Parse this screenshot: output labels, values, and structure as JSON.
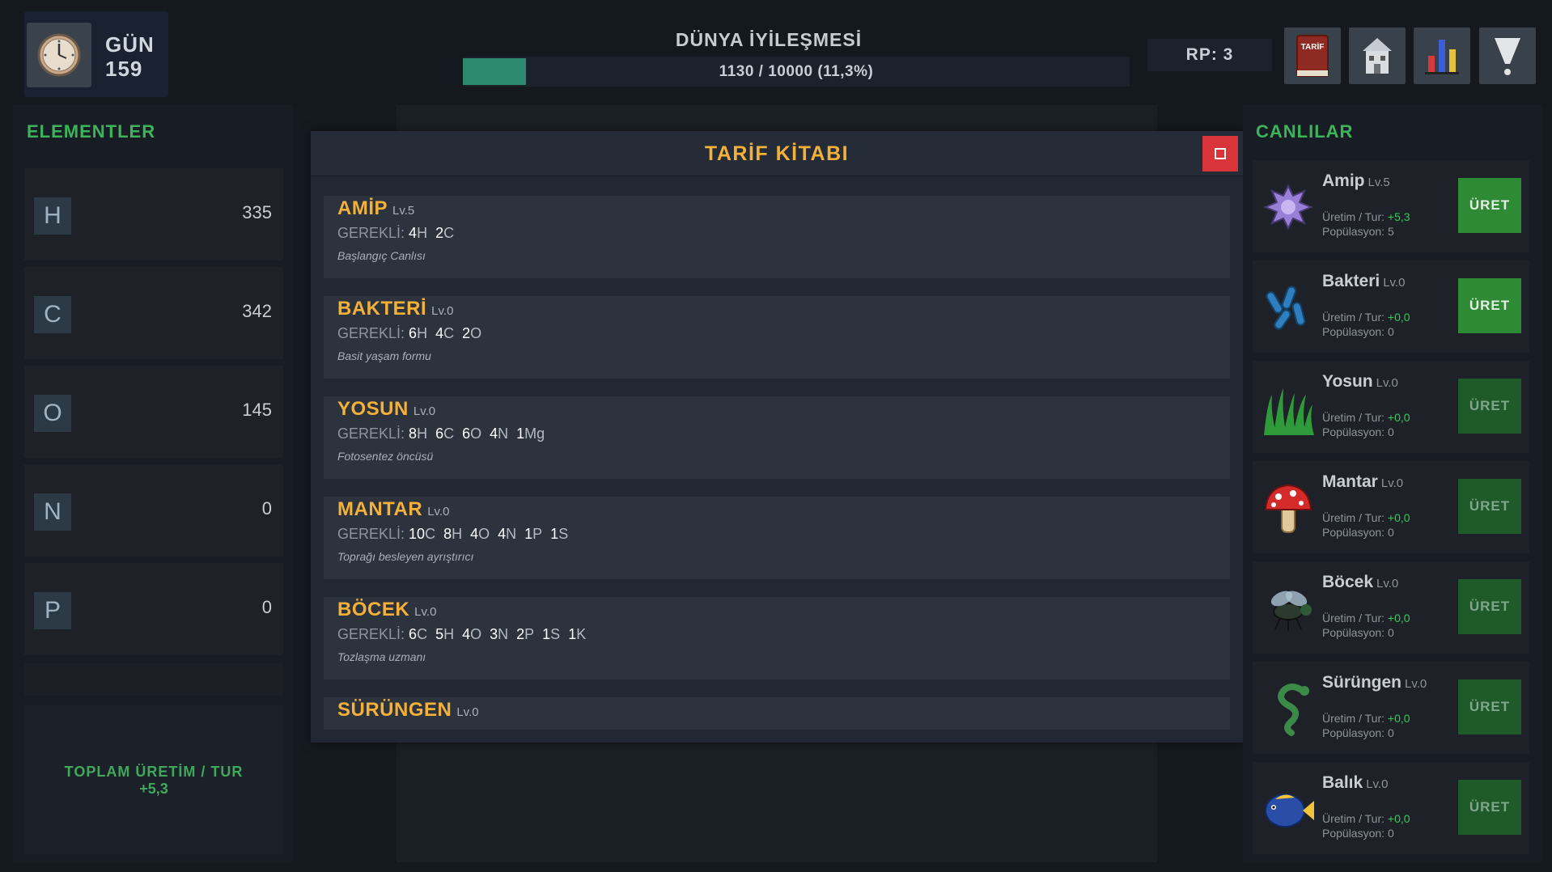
{
  "top": {
    "day_label": "GÜN",
    "day_value": "159",
    "world_title": "DÜNYA İYİLEŞMESİ",
    "progress_text": "1130 / 10000 (11,3%)",
    "progress_fraction": 0.113,
    "rp_text": "RP: 3",
    "book_icon_text": "TARİF",
    "buttons": [
      "book-icon",
      "house-icon",
      "bar-chart-icon",
      "funnel-icon"
    ]
  },
  "elements": {
    "title": "ELEMENTLER",
    "items": [
      {
        "symbol": "H",
        "value": "335"
      },
      {
        "symbol": "C",
        "value": "342"
      },
      {
        "symbol": "O",
        "value": "145"
      },
      {
        "symbol": "N",
        "value": "0"
      },
      {
        "symbol": "P",
        "value": "0"
      }
    ],
    "total_label": "TOPLAM ÜRETİM / TUR",
    "total_value": "+5,3"
  },
  "modal": {
    "title": "TARİF KİTABI",
    "recipes": [
      {
        "name": "AMİP",
        "level": "Lv.5",
        "req_label": "GEREKLİ:",
        "req": [
          [
            "4",
            "H"
          ],
          [
            "2",
            "C"
          ]
        ],
        "desc": "Başlangıç Canlısı"
      },
      {
        "name": "BAKTERİ",
        "level": "Lv.0",
        "req_label": "GEREKLİ:",
        "req": [
          [
            "6",
            "H"
          ],
          [
            "4",
            "C"
          ],
          [
            "2",
            "O"
          ]
        ],
        "desc": "Basit yaşam formu"
      },
      {
        "name": "YOSUN",
        "level": "Lv.0",
        "req_label": "GEREKLİ:",
        "req": [
          [
            "8",
            "H"
          ],
          [
            "6",
            "C"
          ],
          [
            "6",
            "O"
          ],
          [
            "4",
            "N"
          ],
          [
            "1",
            "Mg"
          ]
        ],
        "desc": "Fotosentez öncüsü"
      },
      {
        "name": "MANTAR",
        "level": "Lv.0",
        "req_label": "GEREKLİ:",
        "req": [
          [
            "10",
            "C"
          ],
          [
            "8",
            "H"
          ],
          [
            "4",
            "O"
          ],
          [
            "4",
            "N"
          ],
          [
            "1",
            "P"
          ],
          [
            "1",
            "S"
          ]
        ],
        "desc": "Toprağı besleyen ayrıştırıcı"
      },
      {
        "name": "BÖCEK",
        "level": "Lv.0",
        "req_label": "GEREKLİ:",
        "req": [
          [
            "6",
            "C"
          ],
          [
            "5",
            "H"
          ],
          [
            "4",
            "O"
          ],
          [
            "3",
            "N"
          ],
          [
            "2",
            "P"
          ],
          [
            "1",
            "S"
          ],
          [
            "1",
            "K"
          ]
        ],
        "desc": "Tozlaşma uzmanı"
      },
      {
        "name": "SÜRÜNGEN",
        "level": "Lv.0",
        "req_label": "",
        "req": [],
        "desc": ""
      }
    ]
  },
  "creatures": {
    "title": "CANLILAR",
    "prod_label": "Üretim / Tur:",
    "pop_label": "Popülasyon:",
    "button_label": "ÜRET",
    "items": [
      {
        "name": "Amip",
        "level": "Lv.5",
        "prod": "+5,3",
        "pop": "5",
        "icon": "amoeba-icon",
        "active": true
      },
      {
        "name": "Bakteri",
        "level": "Lv.0",
        "prod": "+0,0",
        "pop": "0",
        "icon": "bacteria-icon",
        "active": true
      },
      {
        "name": "Yosun",
        "level": "Lv.0",
        "prod": "+0,0",
        "pop": "0",
        "icon": "algae-icon",
        "active": false
      },
      {
        "name": "Mantar",
        "level": "Lv.0",
        "prod": "+0,0",
        "pop": "0",
        "icon": "mushroom-icon",
        "active": false
      },
      {
        "name": "Böcek",
        "level": "Lv.0",
        "prod": "+0,0",
        "pop": "0",
        "icon": "fly-icon",
        "active": false
      },
      {
        "name": "Sürüngen",
        "level": "Lv.0",
        "prod": "+0,0",
        "pop": "0",
        "icon": "snake-icon",
        "active": false
      },
      {
        "name": "Balık",
        "level": "Lv.0",
        "prod": "+0,0",
        "pop": "0",
        "icon": "fish-icon",
        "active": false
      }
    ]
  }
}
